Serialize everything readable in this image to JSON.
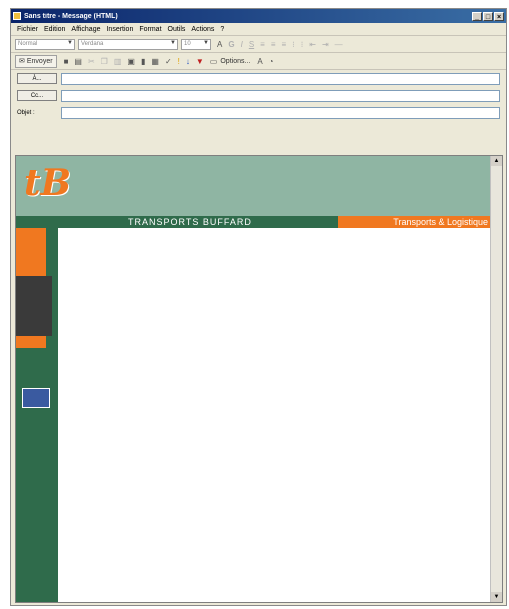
{
  "window": {
    "title": "Sans titre - Message (HTML)"
  },
  "window_buttons": {
    "minimize": "_",
    "maximize": "□",
    "close": "×"
  },
  "menu": [
    "Fichier",
    "Edition",
    "Affichage",
    "Insertion",
    "Format",
    "Outils",
    "Actions",
    "?"
  ],
  "format_toolbar": {
    "style_value": "Normal",
    "font_value": "Verdana",
    "size_value": "10",
    "buttons": [
      "A",
      "G",
      "I",
      "S"
    ]
  },
  "main_toolbar": {
    "send_label": "Envoyer",
    "options_label": "Options..."
  },
  "headers": {
    "to_label": "À...",
    "cc_label": "Cc...",
    "subject_label": "Objet :",
    "to_value": "",
    "cc_value": "",
    "subject_value": ""
  },
  "body": {
    "company_name": "TRANSPORTS BUFFARD",
    "tagline": "Transports & Logistique"
  }
}
